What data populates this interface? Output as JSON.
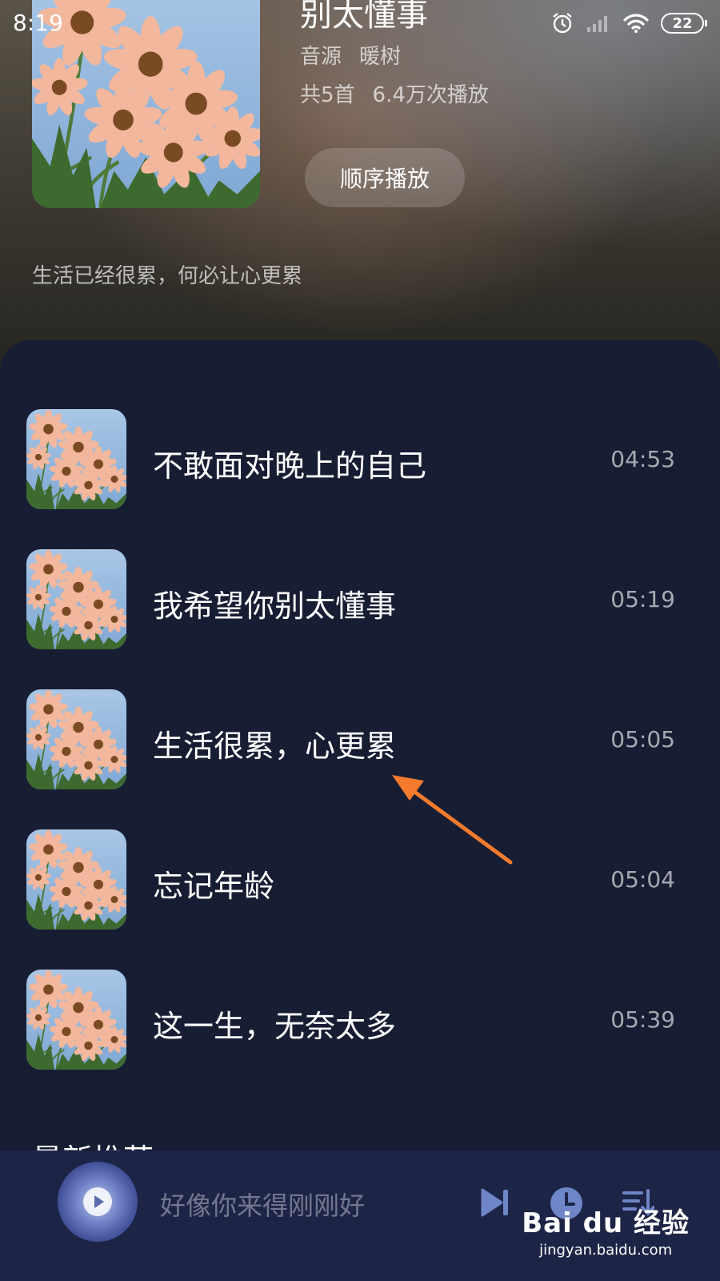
{
  "status_bar": {
    "time": "8:19",
    "battery": "22"
  },
  "album": {
    "title": "别太懂事",
    "source_label": "音源",
    "source_name": "暖树",
    "track_count": "共5首",
    "plays": "6.4万次播放",
    "play_order_label": "顺序播放",
    "description": "生活已经很累，何必让心更累"
  },
  "songs": [
    {
      "title": "不敢面对晚上的自己",
      "duration": "04:53"
    },
    {
      "title": "我希望你别太懂事",
      "duration": "05:19"
    },
    {
      "title": "生活很累，心更累",
      "duration": "05:05"
    },
    {
      "title": "忘记年龄",
      "duration": "05:04"
    },
    {
      "title": "这一生，无奈太多",
      "duration": "05:39"
    }
  ],
  "section": {
    "title": "最新推荐"
  },
  "player": {
    "now_playing": "好像你来得刚刚好",
    "next_icon": "skip-next-icon",
    "timer_icon": "clock-icon",
    "playlist_icon": "playlist-icon"
  },
  "watermark": {
    "logo": "Bai du 经验",
    "url": "jingyan.baidu.com"
  },
  "colors": {
    "panel_background": "#171d33",
    "player_background": "#1d2547",
    "annotation_arrow": "#f47a2c"
  }
}
